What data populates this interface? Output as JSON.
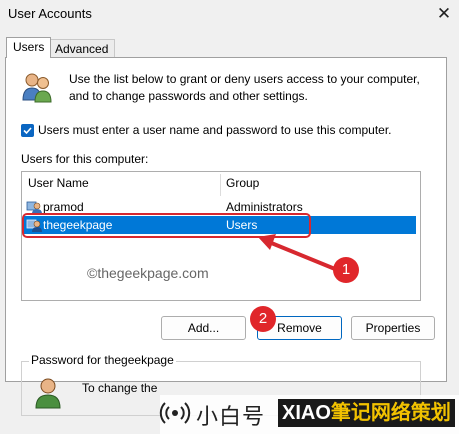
{
  "window": {
    "title": "User Accounts",
    "close_label": "✕"
  },
  "tabs": [
    {
      "label": "Users",
      "active": true
    },
    {
      "label": "Advanced",
      "active": false
    }
  ],
  "intro_text_line1": "Use the list below to grant or deny users access to your computer,",
  "intro_text_line2": "and to change passwords and other settings.",
  "require_login": {
    "checked": true,
    "label": "Users must enter a user name and password to use this computer."
  },
  "users_list": {
    "label": "Users for this computer:",
    "columns": [
      "User Name",
      "Group"
    ],
    "rows": [
      {
        "user": "pramod",
        "group": "Administrators",
        "selected": false
      },
      {
        "user": "thegeekpage",
        "group": "Users",
        "selected": true
      }
    ]
  },
  "overlay_watermark": "©thegeekpage.com",
  "annotations": {
    "step1": "1",
    "step2": "2"
  },
  "buttons": {
    "add": "Add...",
    "remove": "Remove",
    "properties": "Properties"
  },
  "password_group": {
    "label": "Password for thegeekpage",
    "text": "To change the"
  },
  "bottom_banner": {
    "text_left": "小白号",
    "text_box": "XIAO",
    "text_box_yellow": "筆记网络策划"
  },
  "colors": {
    "selection": "#0078d7",
    "annotation_red": "#d7282f",
    "accent": "#0a66c2"
  }
}
